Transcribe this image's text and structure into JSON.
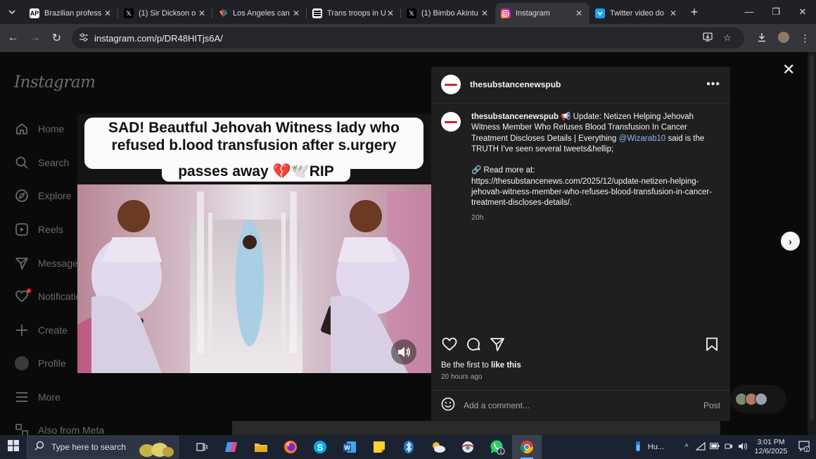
{
  "browser": {
    "tabs": [
      {
        "title": "Brazilian profess",
        "favicon": "AP"
      },
      {
        "title": "(1) Sir Dickson o",
        "favicon": "X"
      },
      {
        "title": "Los Angeles can",
        "favicon": "NBC"
      },
      {
        "title": "Trans troops in U",
        "favicon": "news"
      },
      {
        "title": "(1) Bimbo Akintu",
        "favicon": "X"
      },
      {
        "title": "Instagram",
        "favicon": "instagram",
        "active": true
      },
      {
        "title": "Twitter video do",
        "favicon": "download"
      }
    ],
    "url": "instagram.com/p/DR48HITjs6A/"
  },
  "instagram": {
    "logo": "Instagram",
    "sidebar": [
      {
        "label": "Home",
        "icon": "home-icon"
      },
      {
        "label": "Search",
        "icon": "search-icon"
      },
      {
        "label": "Explore",
        "icon": "explore-icon"
      },
      {
        "label": "Reels",
        "icon": "reels-icon"
      },
      {
        "label": "Messages",
        "icon": "messages-icon"
      },
      {
        "label": "Notifications",
        "icon": "heart-icon"
      },
      {
        "label": "Create",
        "icon": "plus-icon"
      },
      {
        "label": "Profile",
        "icon": "avatar"
      },
      {
        "label": "More",
        "icon": "menu-icon"
      },
      {
        "label": "Also from Meta",
        "icon": "meta-icon"
      }
    ],
    "media": {
      "caption_line1": "SAD! Beautful Jehovah Witness lady who",
      "caption_line2": "refused b.lood transfusion after s.urgery",
      "caption_line3": "passes away 💔🕊️RIP"
    },
    "post": {
      "username": "thesubstancenewspub",
      "caption_intro": "📢 Update: Netizen Helping Jehovah Witness Member Who Refuses Blood Transfusion In Cancer Treatment Discloses Details | Everything ",
      "mention": "@Wizarab10",
      "caption_rest": " said is the TRUTH I've seen several tweets&hellip;",
      "readmore_label": "🔗 Read more at:",
      "link": "https://thesubstancenews.com/2025/12/update-netizen-helping-jehovah-witness-member-who-refuses-blood-transfusion-in-cancer-treatment-discloses-details/.",
      "caption_time": "20h",
      "likes_prefix": "Be the first to ",
      "likes_cta": "like this",
      "posted_ago": "20 hours ago",
      "comment_placeholder": "Add a comment...",
      "post_label": "Post"
    }
  },
  "taskbar": {
    "search_placeholder": "Type here to search",
    "tray_text": "Hu...",
    "whatsapp_badge": "1",
    "time": "3:01 PM",
    "date": "12/6/2025",
    "notif_count": "1"
  }
}
